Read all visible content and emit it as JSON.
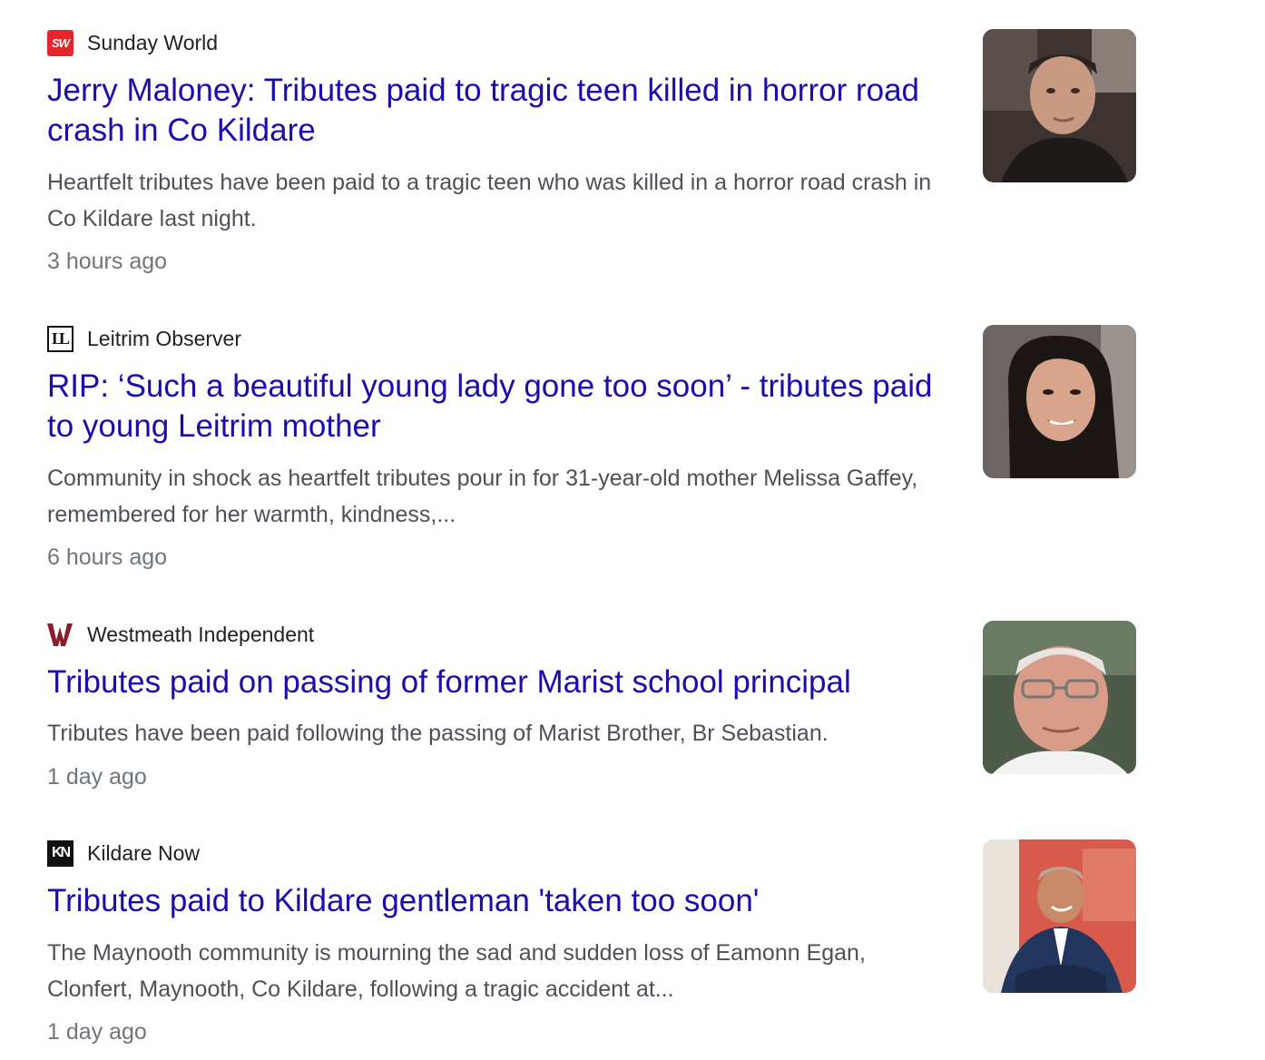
{
  "articles": [
    {
      "source": "Sunday World",
      "logo_text": "SW",
      "logo_icon": "sunday-world-logo-icon",
      "headline": "Jerry Maloney: Tributes paid to tragic teen killed in horror road crash in Co Kildare",
      "snippet": "Heartfelt tributes have been paid to a tragic teen who was killed in a horror road crash in Co Kildare last night.",
      "time": "3 hours ago"
    },
    {
      "source": "Leitrim Observer",
      "logo_text": "LL",
      "logo_icon": "leitrim-observer-logo-icon",
      "headline": "RIP: ‘Such a beautiful young lady gone too soon’ - tributes paid to young Leitrim mother",
      "snippet": "Community in shock as heartfelt tributes pour in for 31-year-old mother Melissa Gaffey, remembered for her warmth, kindness,...",
      "time": "6 hours ago"
    },
    {
      "source": "Westmeath Independent",
      "logo_text": "",
      "logo_icon": "westmeath-independent-logo-icon",
      "headline": "Tributes paid on passing of former Marist school principal",
      "snippet": "Tributes have been paid following the passing of Marist Brother, Br Sebastian.",
      "time": "1 day ago"
    },
    {
      "source": "Kildare Now",
      "logo_text": "KN",
      "logo_icon": "kildare-now-logo-icon",
      "headline": "Tributes paid to Kildare gentleman 'taken too soon'",
      "snippet": "The Maynooth community is mourning the sad and sudden loss of Eamonn Egan, Clonfert, Maynooth, Co Kildare, following a tragic accident at...",
      "time": "1 day ago"
    }
  ],
  "colors": {
    "headline": "#1a0dab",
    "snippet": "#4d5156",
    "time": "#70757a",
    "source": "#202124",
    "sunday_world_red": "#e3262b",
    "westmeath_maroon": "#8b1a2b"
  }
}
